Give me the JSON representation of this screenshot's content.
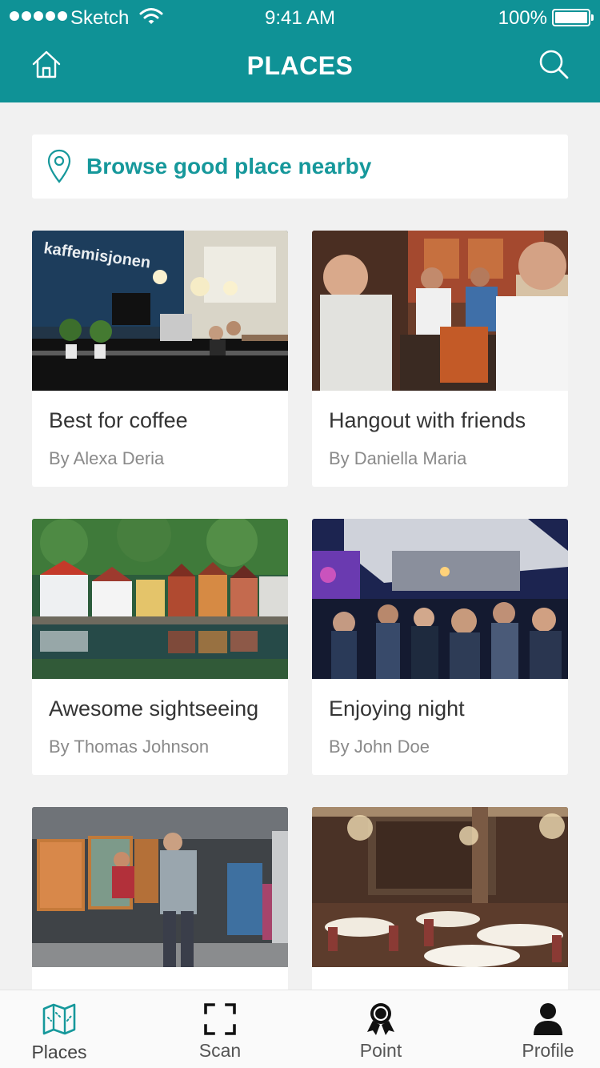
{
  "status_bar": {
    "carrier": "Sketch",
    "time": "9:41 AM",
    "battery": "100%"
  },
  "header": {
    "title": "PLACES",
    "color": "#0f9296"
  },
  "browse": {
    "label": "Browse good place nearby",
    "accent": "#16989b"
  },
  "cards": [
    {
      "title": "Best for coffee",
      "author": "By Alexa Deria"
    },
    {
      "title": "Hangout with friends",
      "author": "By Daniella Maria"
    },
    {
      "title": "Awesome sightseeing",
      "author": "By Thomas Johnson"
    },
    {
      "title": "Enjoying night",
      "author": "By John Doe"
    },
    {
      "title": "",
      "author": ""
    },
    {
      "title": "",
      "author": ""
    }
  ],
  "tabs": [
    {
      "label": "Places",
      "icon": "map-icon",
      "active": true
    },
    {
      "label": "Scan",
      "icon": "scan-icon",
      "active": false
    },
    {
      "label": "Point",
      "icon": "award-icon",
      "active": false
    },
    {
      "label": "Profile",
      "icon": "user-icon",
      "active": false
    }
  ]
}
